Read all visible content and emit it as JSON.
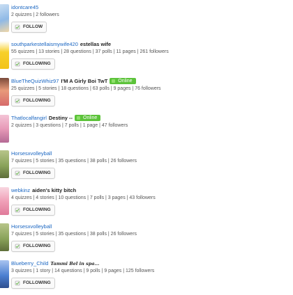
{
  "users": [
    {
      "name": "idontcare45",
      "title": "",
      "online": "",
      "stats": "2 quizzes | 2 followers",
      "button": "FOLLOW",
      "avatar_color": "#8fb9e6"
    },
    {
      "name": "southparkestellaismywife420",
      "title": "estellas wife",
      "online": "",
      "stats": "55 quizzes | 13 stories | 28 questions | 37 polls | 11 pages | 261 followers",
      "button": "FOLLOWING",
      "avatar_color": "#f2c318"
    },
    {
      "name": "BlueTheQuizWhiz97",
      "title": "I'M A Girly Boi TwT",
      "online": "Online",
      "stats": "25 quizzes | 5 stories | 18 questions | 63 polls | 9 pages | 76 followers",
      "button": "FOLLOWING",
      "avatar_color": "#e89a7a"
    },
    {
      "name": "Thatlocalfangirl",
      "title": "Destiny --",
      "online": "Online",
      "stats": "2 quizzes | 3 questions | 7 polls | 1 page | 47 followers",
      "button": "",
      "avatar_color": "#e79ab8"
    },
    {
      "name": "Horsesxvolleyball",
      "title": "",
      "online": "",
      "stats": "7 quizzes | 5 stories | 35 questions | 38 polls | 26 followers",
      "button": "FOLLOWING",
      "avatar_color": "#8aa35a"
    },
    {
      "name": "webkinz",
      "title": "aiden's kitty bitch",
      "online": "",
      "stats": "4 quizzes | 4 stories | 10 questions | 7 polls | 3 pages | 43 followers",
      "button": "FOLLOWING",
      "avatar_color": "#f0a0b8"
    },
    {
      "name": "Horsesxvolleyball",
      "title": "",
      "online": "",
      "stats": "7 quizzes | 5 stories | 35 questions | 38 polls | 26 followers",
      "button": "FOLLOWING",
      "avatar_color": "#8aa35a"
    },
    {
      "name": "Blueberry_Child",
      "title": "Tammi Bel in spa...",
      "online": "",
      "stats": "3 quizzes | 1 story | 14 questions | 9 polls | 9 pages | 125 followers",
      "button": "FOLLOWING",
      "avatar_color": "#4b7fd1"
    }
  ]
}
